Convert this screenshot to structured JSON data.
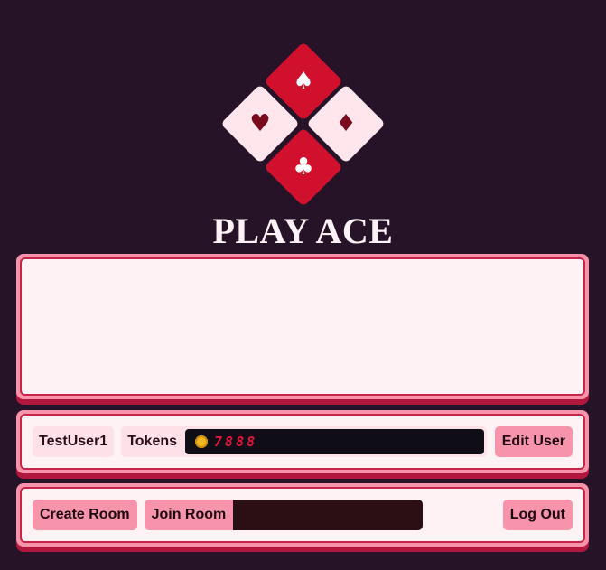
{
  "app": {
    "title": "PLAY ACE",
    "logo_suits": {
      "spade": "♠",
      "heart": "♥",
      "diamond": "♦",
      "club": "♣"
    }
  },
  "message_panel": {
    "text": ""
  },
  "user_bar": {
    "username": "TestUser1",
    "tokens_label": "Tokens",
    "tokens_value": "7888",
    "coin_icon": "coin-icon",
    "edit_button": "Edit User"
  },
  "room_bar": {
    "create_button": "Create Room",
    "join_button": "Join Room",
    "join_input_value": "",
    "logout_button": "Log Out"
  },
  "colors": {
    "background": "#271327",
    "accent_red": "#d0102c",
    "accent_pink": "#f793ab",
    "panel_bg": "#fff2f5"
  }
}
